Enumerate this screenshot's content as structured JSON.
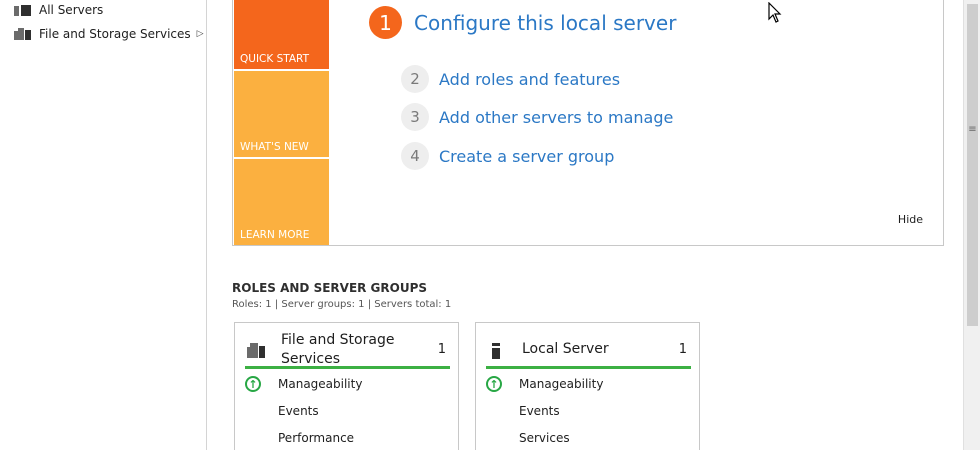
{
  "sidebar": {
    "items": [
      {
        "label": "All Servers",
        "icon": "all-servers-icon"
      },
      {
        "label": "File and Storage Services",
        "icon": "file-storage-icon",
        "arrow": "▷"
      }
    ]
  },
  "welcome": {
    "tiles": [
      {
        "label": "QUICK START"
      },
      {
        "label": "WHAT'S NEW"
      },
      {
        "label": "LEARN MORE"
      }
    ],
    "steps": [
      {
        "num": "1",
        "label": "Configure this local server"
      },
      {
        "num": "2",
        "label": "Add roles and features"
      },
      {
        "num": "3",
        "label": "Add other servers to manage"
      },
      {
        "num": "4",
        "label": "Create a server group"
      }
    ],
    "hide_label": "Hide"
  },
  "roles": {
    "title": "ROLES AND SERVER GROUPS",
    "summary": "Roles: 1   |   Server groups: 1   |   Servers total: 1",
    "cards": [
      {
        "title_line1": "File and Storage",
        "title_line2": "Services",
        "count": "1",
        "rows": [
          "Manageability",
          "Events",
          "Performance"
        ]
      },
      {
        "title": "Local Server",
        "count": "1",
        "rows": [
          "Manageability",
          "Events",
          "Services"
        ]
      }
    ]
  },
  "scrollbar": {
    "grip": "≡"
  },
  "colors": {
    "accent_orange": "#f4661c",
    "tile_orange": "#fbb040",
    "link_blue": "#2b78c5",
    "status_green": "#3cb043"
  }
}
